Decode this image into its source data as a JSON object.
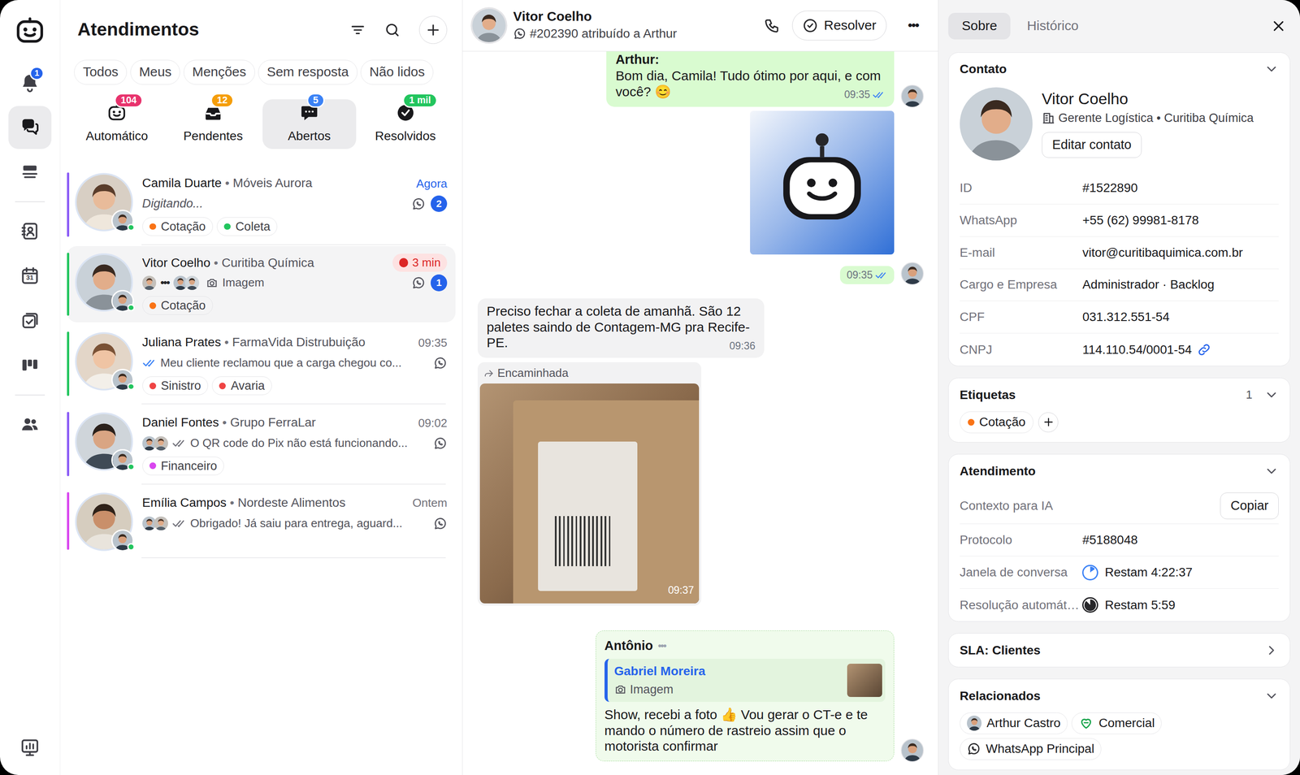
{
  "nav": {
    "items": [
      {
        "selected": false,
        "badge": "1"
      },
      {
        "selected": true
      },
      {
        "selected": false
      },
      {
        "selected": false
      },
      {
        "selected": false,
        "text": "31"
      },
      {
        "selected": false
      },
      {
        "selected": false
      },
      {
        "selected": false
      },
      {
        "selected": false
      }
    ]
  },
  "list": {
    "title": "Atendimentos",
    "separator": "•",
    "filters": [
      {
        "label": "Todos",
        "selected": false
      },
      {
        "label": "Meus",
        "selected": false
      },
      {
        "label": "Menções",
        "selected": false
      },
      {
        "label": "Sem resposta",
        "selected": false
      },
      {
        "label": "Não lidos",
        "selected": false
      }
    ],
    "queues": [
      {
        "label": "Automático",
        "count": "104",
        "color": "#e8336d",
        "selected": false
      },
      {
        "label": "Pendentes",
        "count": "12",
        "color": "#f59e0b",
        "selected": false
      },
      {
        "label": "Abertos",
        "count": "5",
        "color": "#3b82f6",
        "selected": true
      },
      {
        "label": "Resolvidos",
        "count": "1 mil",
        "color": "#22c55e",
        "selected": false
      }
    ],
    "conversations": [
      {
        "name": "Camila Duarte",
        "company": "Móveis Aurora",
        "time": "Agora",
        "time_kind": "now",
        "preview_kind": "typing",
        "preview": "Digitando...",
        "unread": "2",
        "bar_color": "#8b5cf6",
        "selected": false,
        "tags": [
          {
            "label": "Cotação",
            "color": "#f97316"
          },
          {
            "label": "Coleta",
            "color": "#22c55e"
          }
        ]
      },
      {
        "name": "Vitor Coelho",
        "company": "Curitiba Química",
        "time": "3 min",
        "time_kind": "overdue",
        "preview_kind": "media",
        "dots": "•••",
        "preview": "Imagem",
        "unread": "1",
        "bar_color": "#22c55e",
        "selected": true,
        "tags": [
          {
            "label": "Cotação",
            "color": "#f97316"
          }
        ]
      },
      {
        "name": "Juliana Prates",
        "company": "FarmaVida Distrubuição",
        "time": "09:35",
        "time_kind": "plain",
        "preview_kind": "read",
        "preview": "Meu cliente reclamou que a carga chegou co...",
        "bar_color": "#22c55e",
        "selected": false,
        "tags": [
          {
            "label": "Sinistro",
            "color": "#ef4444"
          },
          {
            "label": "Avaria",
            "color": "#ef4444"
          }
        ]
      },
      {
        "name": "Daniel Fontes",
        "company": "Grupo FerraLar",
        "time": "09:02",
        "time_kind": "plain",
        "preview_kind": "delivered",
        "preview": "O QR code do Pix não está funcionando...",
        "bar_color": "#8b5cf6",
        "selected": false,
        "tags": [
          {
            "label": "Financeiro",
            "color": "#d946ef"
          }
        ]
      },
      {
        "name": "Emília Campos",
        "company": "Nordeste Alimentos",
        "time": "Ontem",
        "time_kind": "plain",
        "preview_kind": "delivered",
        "preview": "Obrigado! Já saiu para entrega, aguard...",
        "bar_color": "#d946ef",
        "selected": false,
        "tags": []
      }
    ]
  },
  "chat": {
    "contact": "Vitor Coelho",
    "subtitle": "#202390 atribuído a Arthur",
    "resolve": "Resolver",
    "more": "•••",
    "messages": [
      {
        "kind": "text",
        "direction": "out",
        "author": "Arthur:",
        "text": "Bom dia, Camila! Tudo ótimo por aqui, e com você? 😊",
        "time": "09:35",
        "read": true
      },
      {
        "kind": "sticker",
        "direction": "out",
        "time": "09:35",
        "read": true
      },
      {
        "kind": "text",
        "direction": "in",
        "text": "Preciso fechar a coleta de amanhã. São 12 paletes saindo de Contagem-MG pra Recife-PE.",
        "time": "09:36"
      },
      {
        "kind": "image",
        "direction": "in",
        "forwarded": "Encaminhada",
        "time": "09:37"
      },
      {
        "kind": "reply",
        "direction": "out",
        "author": "Antônio",
        "typing": "•••",
        "quote_author": "Gabriel Moreira",
        "quote_text": "Imagem",
        "text": "Show, recebi a foto 👍 Vou gerar o CT-e e te mando o número de rastreio assim que o motorista confirmar"
      }
    ]
  },
  "details": {
    "tabs": [
      {
        "label": "Sobre",
        "selected": true
      },
      {
        "label": "Histórico",
        "selected": false
      }
    ],
    "contact": {
      "title": "Contato",
      "expanded": true,
      "name": "Vitor Coelho",
      "role": "Gerente Logística • Curitiba Química",
      "edit": "Editar contato",
      "fields": [
        {
          "label": "ID",
          "value": "#1522890",
          "kind": "plain"
        },
        {
          "label": "WhatsApp",
          "value": "+55 (62) 99981-8178",
          "kind": "plain"
        },
        {
          "label": "E-mail",
          "value": "vitor@curitibaquimica.com.br",
          "kind": "plain"
        },
        {
          "label": "Cargo e Empresa",
          "value": "Administrador · Backlog",
          "kind": "plain"
        },
        {
          "label": "CPF",
          "value": "031.312.551-54",
          "kind": "plain"
        },
        {
          "label": "CNPJ",
          "value": "114.110.54/0001-54",
          "kind": "linked"
        }
      ]
    },
    "tags": {
      "title": "Etiquetas",
      "count": "1",
      "expanded": true,
      "items": [
        {
          "label": "Cotação",
          "color": "#f97316"
        }
      ]
    },
    "service": {
      "title": "Atendimento",
      "expanded": true,
      "rows": [
        {
          "label": "Contexto para IA",
          "kind": "button",
          "value": "Copiar"
        },
        {
          "label": "Protocolo",
          "kind": "text",
          "value": "#5188048"
        },
        {
          "label": "Janela de conversa",
          "kind": "timer",
          "value": "Restam 4:22:37",
          "level": 0.15,
          "color": "#3b82f6"
        },
        {
          "label": "Resolução automát…",
          "kind": "timer",
          "value": "Restam 5:59",
          "level": 0.88,
          "color": "#27272a"
        }
      ]
    },
    "sla": {
      "title": "SLA: Clientes",
      "expanded": false
    },
    "related": {
      "title": "Relacionados",
      "expanded": true,
      "items": [
        {
          "label": "Arthur Castro",
          "kind": "person"
        },
        {
          "label": "Comercial",
          "kind": "team"
        },
        {
          "label": "WhatsApp Principal",
          "kind": "channel"
        }
      ]
    }
  }
}
